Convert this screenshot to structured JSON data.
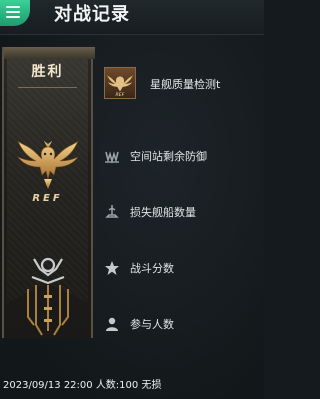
{
  "header": {
    "title": "对战记录"
  },
  "banner": {
    "result": "胜利",
    "emblem_text": "REF"
  },
  "ship": {
    "name": "星舰质量检测t"
  },
  "stats": [
    {
      "icon": "shield-icon",
      "label": "空间站剩余防御"
    },
    {
      "icon": "ship-icon",
      "label": "损失舰船数量"
    },
    {
      "icon": "star-icon",
      "label": "战斗分数"
    },
    {
      "icon": "person-icon",
      "label": "参与人数"
    }
  ],
  "footer": {
    "text": "2023/09/13 22:00 人数:100 无损"
  },
  "colors": {
    "accent": "#2fbf86",
    "gold": "#c9a25d",
    "background": "#141a1d"
  }
}
